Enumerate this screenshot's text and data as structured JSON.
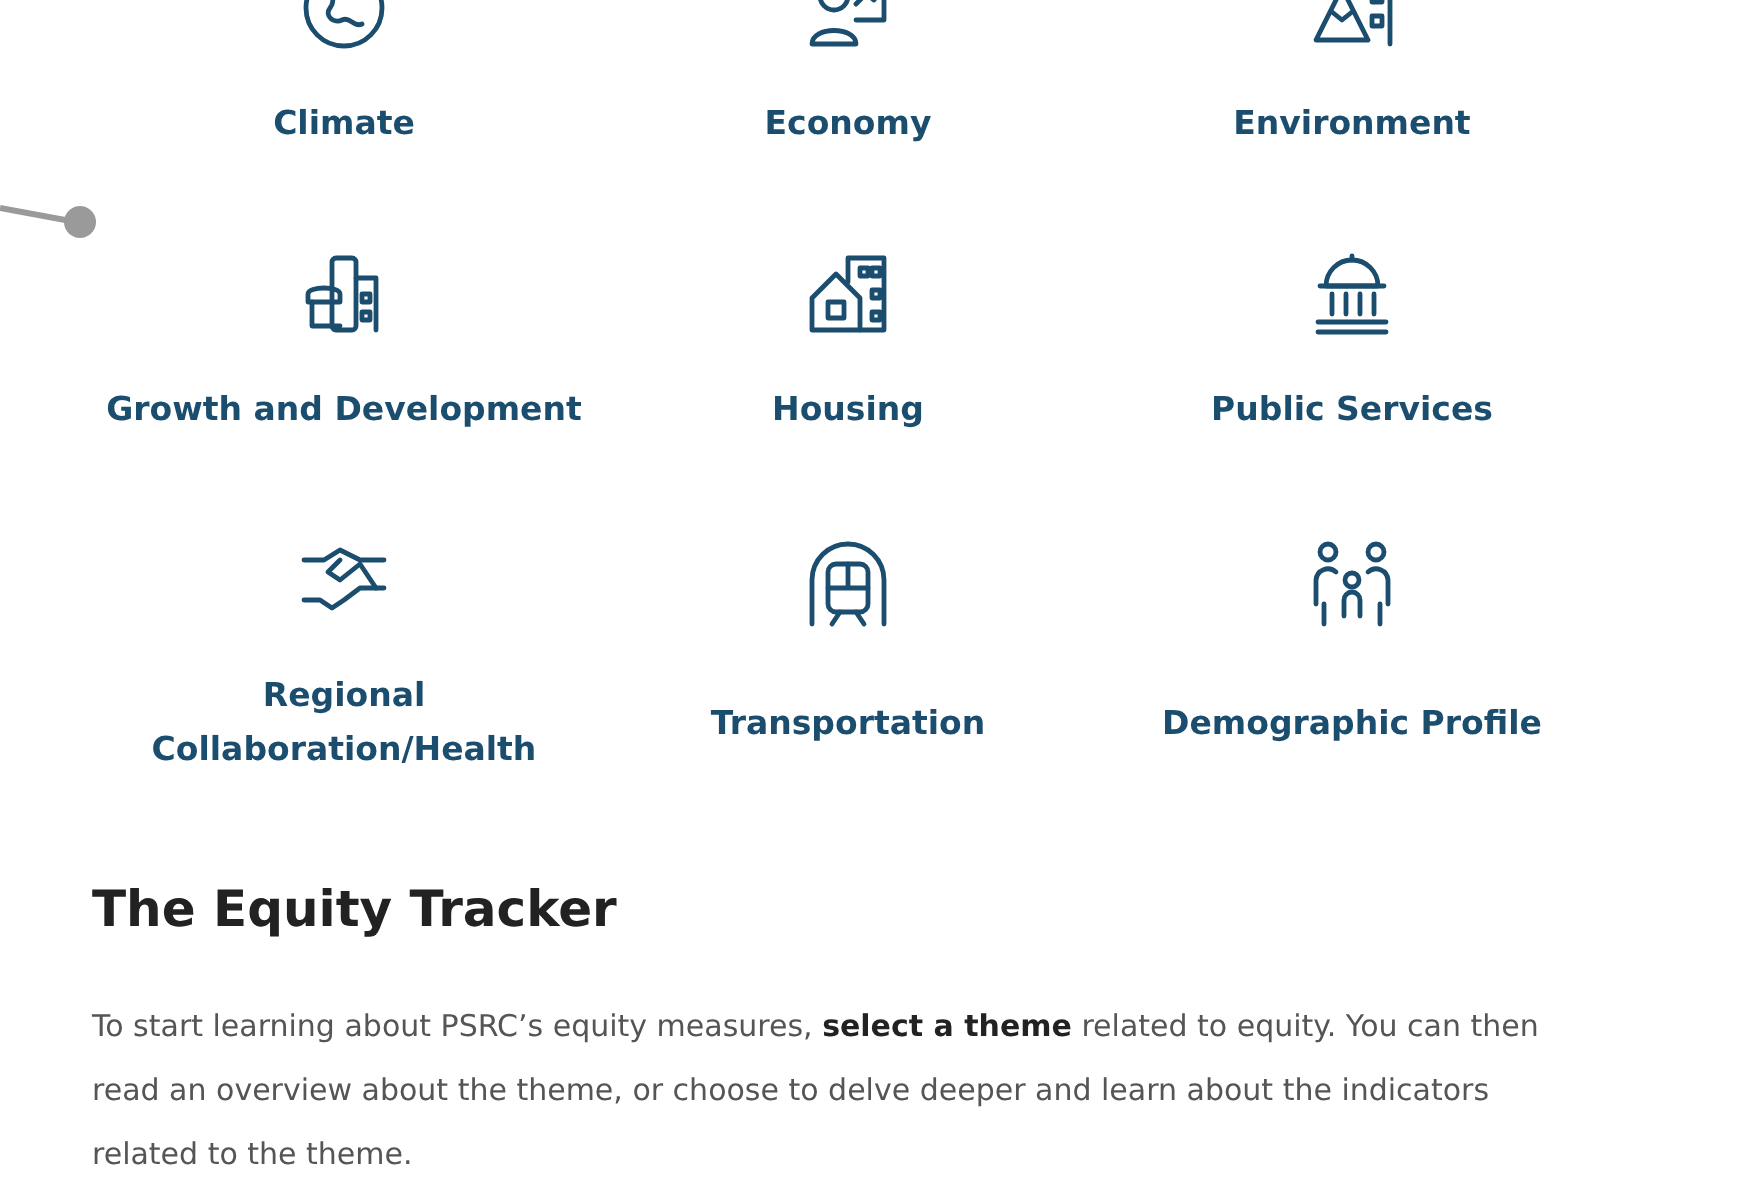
{
  "themes": [
    {
      "label": "Climate"
    },
    {
      "label": "Economy"
    },
    {
      "label": "Environment"
    },
    {
      "label": "Growth and Development"
    },
    {
      "label": "Housing"
    },
    {
      "label": "Public Services"
    },
    {
      "label": "Regional Collaboration/Health"
    },
    {
      "label": "Transportation"
    },
    {
      "label": "Demographic Profile"
    }
  ],
  "section": {
    "title": "The Equity Tracker",
    "text": "To start learning about PSRC’s equity measures, **select a theme** related to equity. You can then read an overview about the theme, or choose to delve deeper and learn about the indicators related to the theme."
  }
}
